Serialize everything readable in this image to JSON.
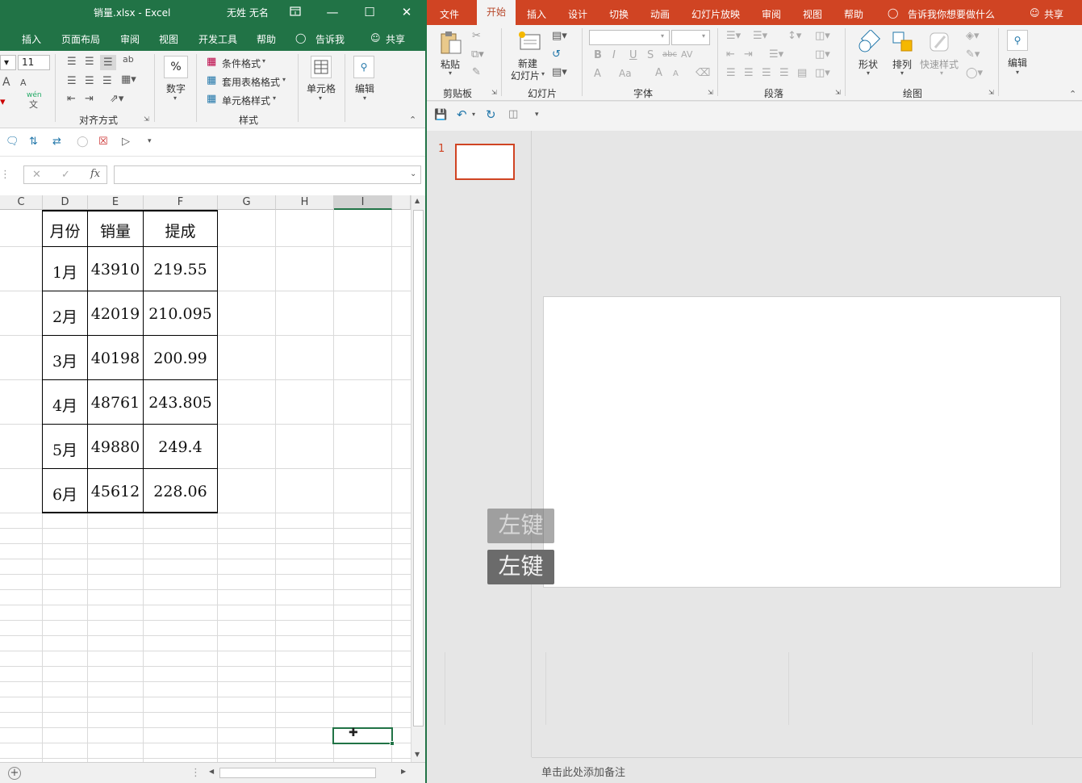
{
  "excel": {
    "window_title": "销量.xlsx  -  Excel",
    "user_name": "无姓 无名",
    "tabs": [
      "插入",
      "页面布局",
      "审阅",
      "视图",
      "开发工具",
      "帮助"
    ],
    "tell_me": "告诉我",
    "share": "共享",
    "ribbon": {
      "font_size": "11",
      "wrap_glyph": "ab",
      "wen_glyph": "wén",
      "wen_sub": "文",
      "font_a_large": "A",
      "font_a_small": "A",
      "align_group": "对齐方式",
      "number_label": "数字",
      "percent": "%",
      "conditional_format": "条件格式",
      "table_format": "套用表格格式",
      "cell_styles": "单元格样式",
      "styles_group": "样式",
      "cells_label": "单元格",
      "edit_label": "编辑"
    },
    "formula_bar": {
      "fx": "fx",
      "cancel": "✕",
      "confirm": "✓",
      "value": ""
    },
    "columns": [
      "C",
      "D",
      "E",
      "F",
      "G",
      "H",
      "I"
    ],
    "table": {
      "headers": [
        "月份",
        "销量",
        "提成"
      ],
      "rows": [
        [
          "1月",
          "43910",
          "219.55"
        ],
        [
          "2月",
          "42019",
          "210.095"
        ],
        [
          "3月",
          "40198",
          "200.99"
        ],
        [
          "4月",
          "48761",
          "243.805"
        ],
        [
          "5月",
          "49880",
          "249.4"
        ],
        [
          "6月",
          "45612",
          "228.06"
        ]
      ]
    },
    "add_sheet": "+"
  },
  "ppt": {
    "tabs": [
      "文件",
      "开始",
      "插入",
      "设计",
      "切换",
      "动画",
      "幻灯片放映",
      "审阅",
      "视图",
      "帮助"
    ],
    "active_tab": "开始",
    "tell_me": "告诉我你想要做什么",
    "share": "共享",
    "ribbon": {
      "paste": "粘贴",
      "clipboard_group": "剪贴板",
      "new_slide_line1": "新建",
      "new_slide_line2": "幻灯片",
      "slides_group": "幻灯片",
      "font_group": "字体",
      "paragraph_group": "段落",
      "shapes": "形状",
      "arrange": "排列",
      "quick_styles": "快速样式",
      "drawing_group": "绘图",
      "edit": "编辑",
      "bold": "B",
      "italic": "I",
      "underline": "U",
      "shadow": "S",
      "strike": "abc",
      "font_color": "A",
      "change_case": "Aa",
      "grow_font": "A",
      "shrink_font": "A",
      "spacing": "AV"
    },
    "slide_number": "1",
    "notes_placeholder": "单击此处添加备注",
    "key_overlay_1": "左键",
    "key_overlay_2": "左键"
  },
  "colors": {
    "excel_green": "#217346",
    "ppt_orange": "#d04423"
  }
}
